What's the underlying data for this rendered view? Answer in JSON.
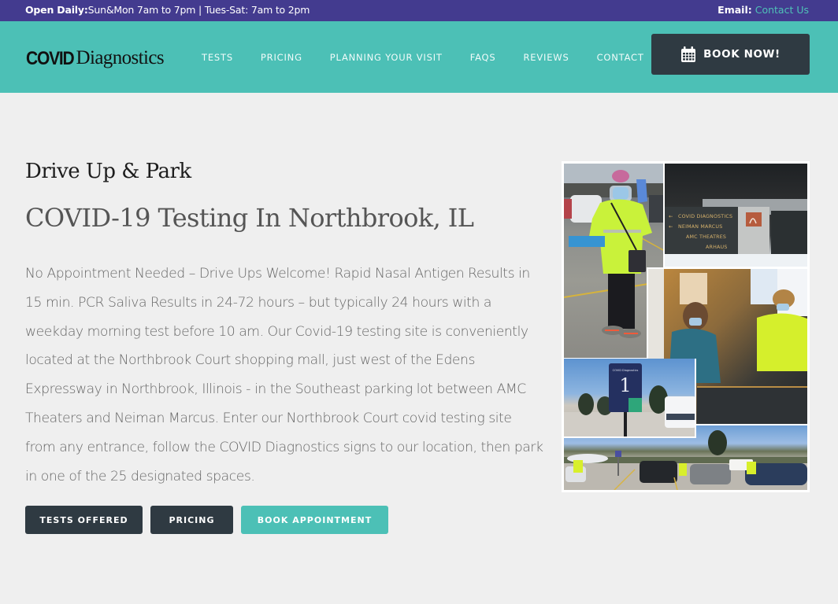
{
  "topbar": {
    "hours_label": "Open Daily:",
    "hours_text": "Sun&Mon 7am to 7pm | Tues-Sat: 7am to 2pm",
    "email_label": "Email:",
    "email_link": "Contact Us"
  },
  "header": {
    "logo_bold": "COVID",
    "logo_rest": "Diagnostics",
    "nav": [
      "TESTS",
      "PRICING",
      "PLANNING YOUR VISIT",
      "FAQS",
      "REVIEWS",
      "CONTACT"
    ],
    "book_now": "BOOK NOW!",
    "book_icon": "calendar-icon"
  },
  "main": {
    "eyebrow": "Drive Up & Park",
    "title": "COVID-19 Testing In Northbrook, IL",
    "description": "No Appointment Needed – Drive Ups Welcome! Rapid Nasal Antigen Results in 15 min. PCR Saliva Results in 24-72 hours – but typically 24 hours with a weekday morning test before 10 am. Our Covid-19 testing site is conveniently located at the Northbrook Court shopping mall, just west of the Edens Expressway in Northbrook, Illinois - in the Southeast parking lot between AMC Theaters and Neiman Marcus. Enter our Northbrook Court covid testing site from any entrance, follow the COVID Diagnostics signs to our location, then park in one of the 25 designated spaces.",
    "buttons": [
      {
        "label": "TESTS OFFERED"
      },
      {
        "label": "PRICING"
      },
      {
        "label": "BOOK APPOINTMENT"
      }
    ]
  },
  "collage": {
    "sign_lines": [
      "COVID DIAGNOSTICS",
      "NEIMAN MARCUS",
      "AMC THEATRES",
      "ARHAUS"
    ],
    "parking_sign_number": "1",
    "parking_sign_brand": "COVID Diagnostics"
  },
  "colors": {
    "topbar": "#433b8f",
    "header": "#4cc0b6",
    "dark_button": "#2f3a42",
    "accent_link": "#4fc1b7",
    "page_bg": "#efefef"
  }
}
